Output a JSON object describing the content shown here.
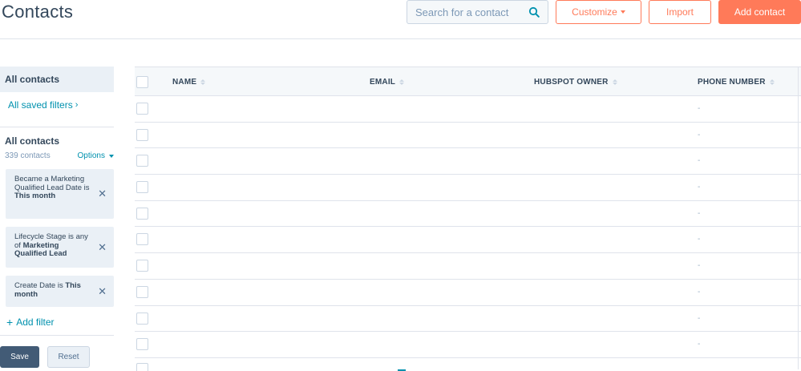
{
  "page_title": "Contacts",
  "search": {
    "placeholder": "Search for a contact",
    "icon": "search-icon"
  },
  "header_buttons": {
    "customize": "Customize",
    "import": "Import",
    "add_contact": "Add contact"
  },
  "colors": {
    "accent": "#ff7a59",
    "link": "#0091ae",
    "text": "#33475b",
    "sidebar_bg": "#eaf0f6",
    "save_bg": "#425b76"
  },
  "sidebar": {
    "tab_label": "All contacts",
    "saved_filters_label": "All saved filters",
    "view_title": "All contacts",
    "contact_count": "339 contacts",
    "options_label": "Options",
    "filters": [
      {
        "text": "Became a Marketing Qualified Lead Date is ",
        "bold": "This month"
      },
      {
        "text": "Lifecycle Stage is any of ",
        "bold": "Marketing Qualified Lead"
      },
      {
        "text": "Create Date is ",
        "bold": "This month"
      }
    ],
    "add_filter_label": "Add filter",
    "save_label": "Save",
    "reset_label": "Reset"
  },
  "table": {
    "columns": [
      "NAME",
      "EMAIL",
      "HUBSPOT OWNER",
      "PHONE NUMBER"
    ],
    "rows": [
      {
        "name": "",
        "email": "",
        "owner": "",
        "phone": "-"
      },
      {
        "name": "",
        "email": "",
        "owner": "",
        "phone": "-"
      },
      {
        "name": "",
        "email": "",
        "owner": "",
        "phone": "-"
      },
      {
        "name": "",
        "email": "",
        "owner": "",
        "phone": "-"
      },
      {
        "name": "",
        "email": "",
        "owner": "",
        "phone": "-"
      },
      {
        "name": "",
        "email": "",
        "owner": "",
        "phone": "-"
      },
      {
        "name": "",
        "email": "",
        "owner": "",
        "phone": "-"
      },
      {
        "name": "",
        "email": "",
        "owner": "",
        "phone": "-"
      },
      {
        "name": "",
        "email": "",
        "owner": "",
        "phone": "-"
      },
      {
        "name": "",
        "email": "",
        "owner": "",
        "phone": "-"
      }
    ]
  }
}
